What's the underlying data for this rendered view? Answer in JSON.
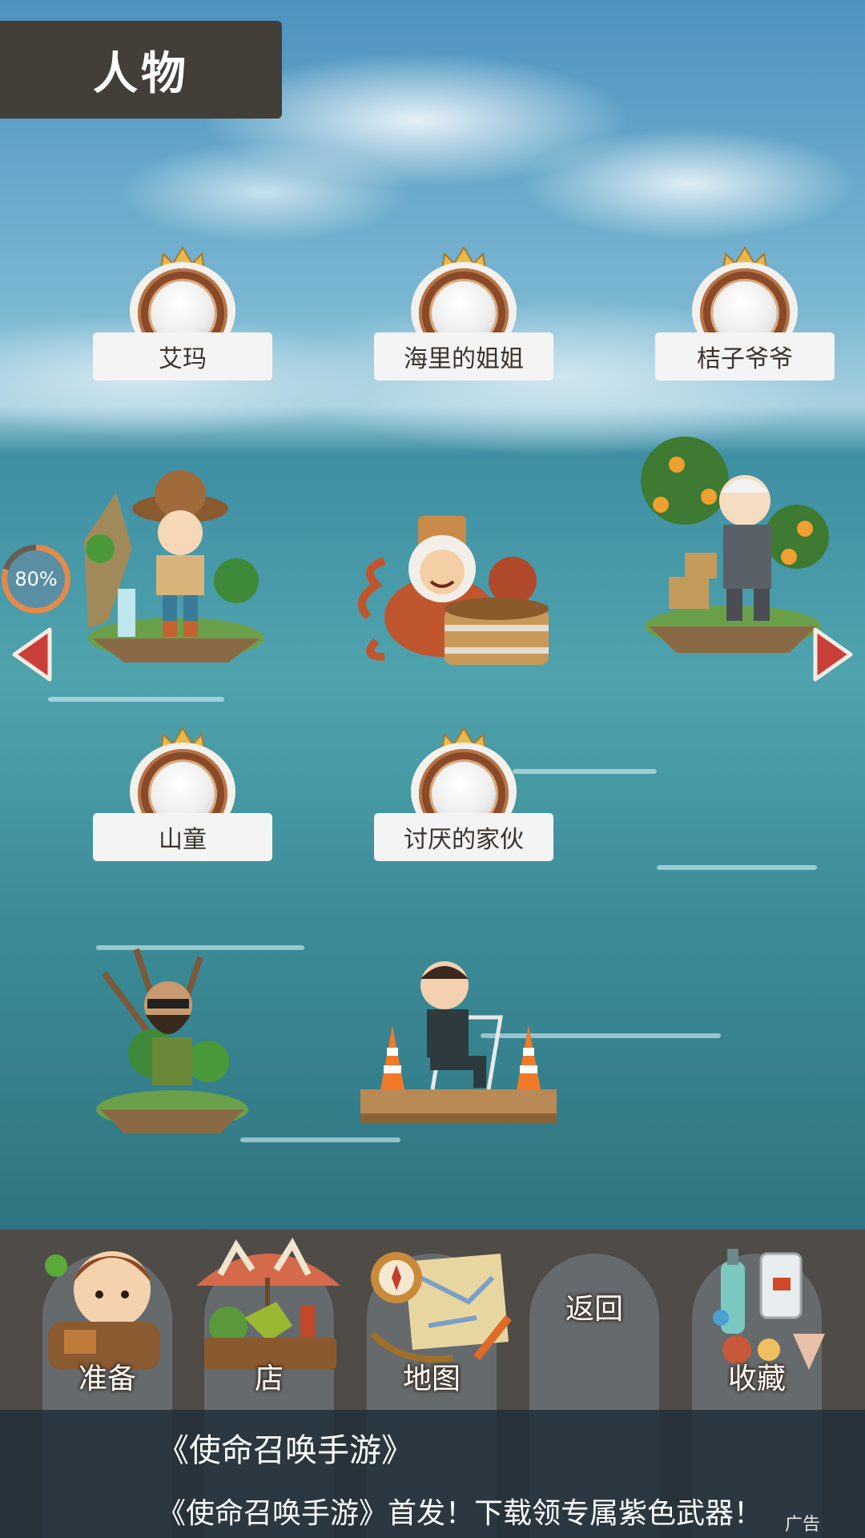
{
  "header": {
    "title": "人物"
  },
  "characters": [
    {
      "name": "艾玛",
      "figure_icon": "explorer-girl-island-icon"
    },
    {
      "name": "海里的姐姐",
      "figure_icon": "octopus-diver-lady-icon"
    },
    {
      "name": "桔子爷爷",
      "figure_icon": "orange-tree-grandpa-icon"
    },
    {
      "name": "山童",
      "figure_icon": "bearded-mountain-man-icon"
    },
    {
      "name": "讨厌的家伙",
      "figure_icon": "suited-man-chair-icon"
    }
  ],
  "progress": {
    "label": "80%",
    "value": 0.8
  },
  "nav": {
    "prev_icon": "arrow-left-icon",
    "next_icon": "arrow-right-icon"
  },
  "bottom_nav": [
    {
      "label": "准备",
      "icon": "backpack-boy-icon"
    },
    {
      "label": "店",
      "icon": "market-stall-icon"
    },
    {
      "label": "地图",
      "icon": "map-compass-icon"
    },
    {
      "label": "返回",
      "icon": ""
    },
    {
      "label": "收藏",
      "icon": "bottles-shells-icon"
    }
  ],
  "ad": {
    "title": "《使命召唤手游》",
    "description": "《使命召唤手游》首发！下载领专属紫色武器！",
    "tag": "广告"
  },
  "colors": {
    "title_bg": "#433e38",
    "medal_ring": "#8a4a28",
    "crown": "#e8b84a",
    "arrow": "#c9403a",
    "bottom_bg": "#4f4b47"
  }
}
